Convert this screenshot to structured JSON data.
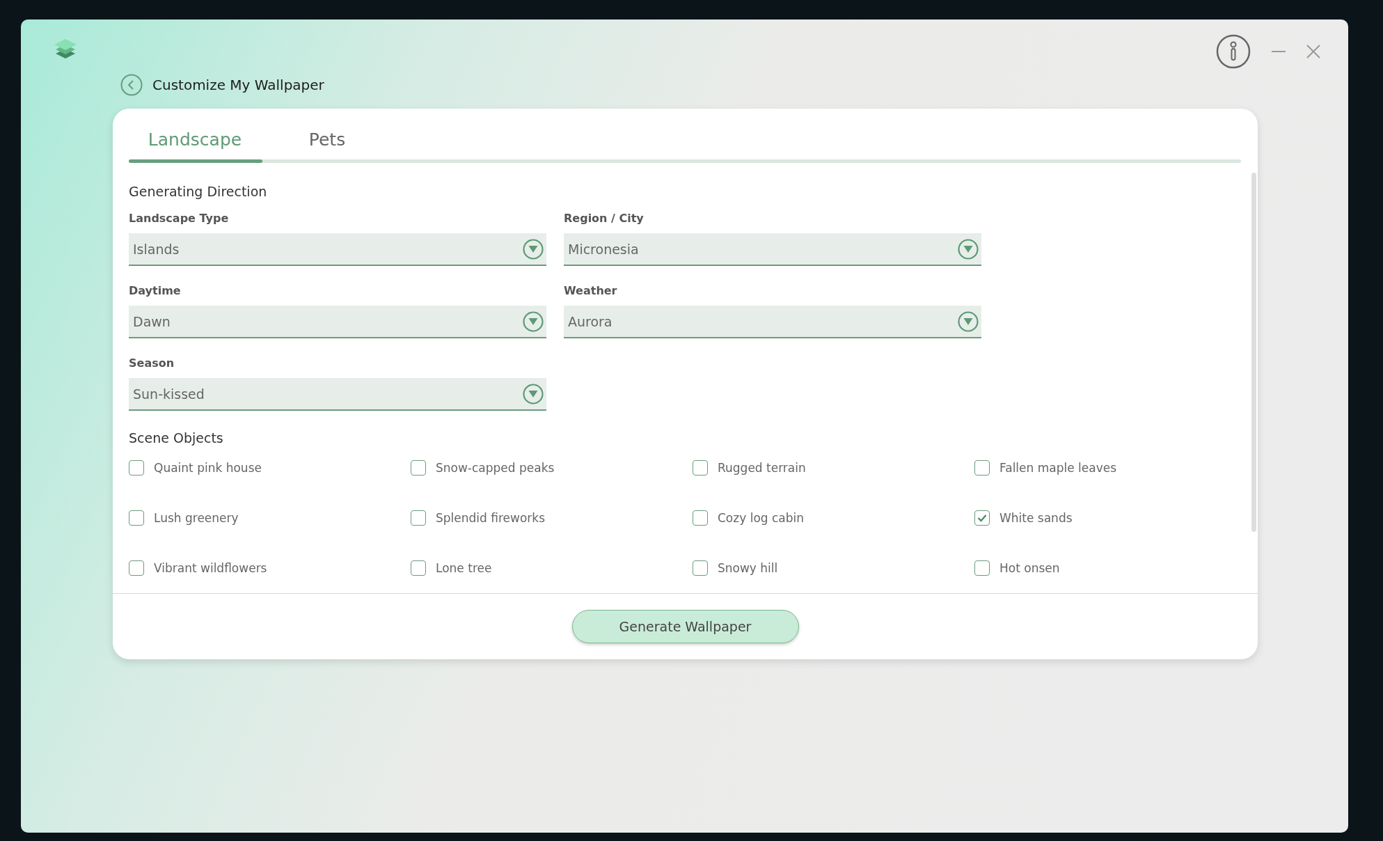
{
  "page": {
    "title": "Customize My Wallpaper"
  },
  "tabs": [
    {
      "label": "Landscape",
      "selected": true
    },
    {
      "label": "Pets",
      "selected": false
    }
  ],
  "generating_direction": {
    "heading": "Generating Direction",
    "fields": [
      {
        "label": "Landscape Type",
        "value": "Islands"
      },
      {
        "label": "Region / City",
        "value": "Micronesia"
      },
      {
        "label": "Daytime",
        "value": "Dawn"
      },
      {
        "label": "Weather",
        "value": "Aurora"
      },
      {
        "label": "Season",
        "value": "Sun-kissed"
      }
    ]
  },
  "scene_objects": {
    "heading": "Scene Objects",
    "items": [
      {
        "label": "Quaint pink house",
        "checked": false
      },
      {
        "label": "Snow-capped peaks",
        "checked": false
      },
      {
        "label": "Rugged terrain",
        "checked": false
      },
      {
        "label": "Fallen maple leaves",
        "checked": false
      },
      {
        "label": "Lush greenery",
        "checked": false
      },
      {
        "label": "Splendid fireworks",
        "checked": false
      },
      {
        "label": "Cozy log cabin",
        "checked": false
      },
      {
        "label": "White sands",
        "checked": true
      },
      {
        "label": "Vibrant wildflowers",
        "checked": false
      },
      {
        "label": "Lone tree",
        "checked": false
      },
      {
        "label": "Snowy hill",
        "checked": false
      },
      {
        "label": "Hot onsen",
        "checked": false
      }
    ]
  },
  "footer": {
    "button": "Generate Wallpaper"
  }
}
